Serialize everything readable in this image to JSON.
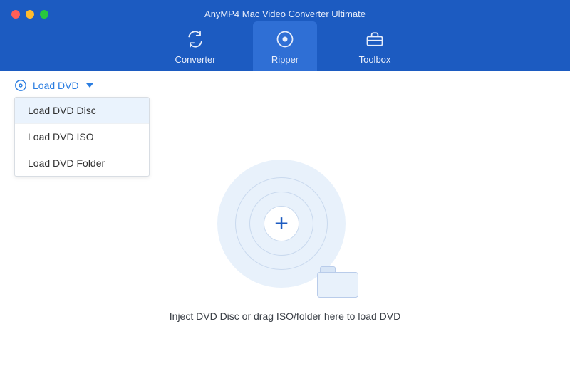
{
  "window": {
    "title": "AnyMP4 Mac Video Converter Ultimate"
  },
  "tabs": {
    "converter": {
      "label": "Converter"
    },
    "ripper": {
      "label": "Ripper"
    },
    "toolbox": {
      "label": "Toolbox"
    },
    "active": "ripper"
  },
  "toolbar": {
    "load_dvd": {
      "label": "Load DVD"
    }
  },
  "dropdown": {
    "items": [
      {
        "label": "Load DVD Disc"
      },
      {
        "label": "Load DVD ISO"
      },
      {
        "label": "Load DVD Folder"
      }
    ],
    "hover_index": 0
  },
  "main": {
    "hint": "Inject DVD Disc or drag ISO/folder here to load DVD"
  },
  "colors": {
    "header_bg": "#1c5bc1",
    "tab_active_bg": "#2f6fd5",
    "accent": "#2a7de1",
    "drop_bg": "#e8f1fb"
  }
}
